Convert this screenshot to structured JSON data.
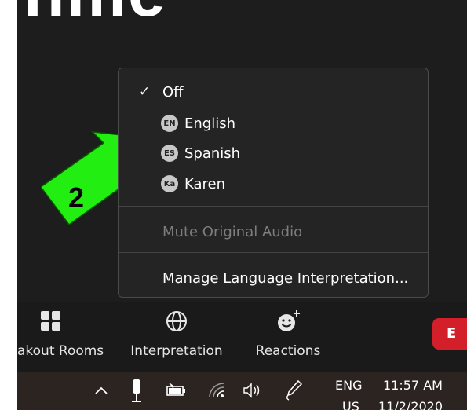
{
  "background": {
    "text": "hme"
  },
  "annotation": {
    "number": "2",
    "arrow_color": "#22ee11"
  },
  "interpretation_menu": {
    "items": [
      {
        "label": "Off",
        "checked": true,
        "badge": ""
      },
      {
        "label": "English",
        "checked": false,
        "badge": "EN"
      },
      {
        "label": "Spanish",
        "checked": false,
        "badge": "ES"
      },
      {
        "label": "Karen",
        "checked": false,
        "badge": "Ka"
      }
    ],
    "mute_original_audio": "Mute Original Audio",
    "manage": "Manage Language Interpretation..."
  },
  "toolbar": {
    "breakout_rooms": "akout Rooms",
    "interpretation": "Interpretation",
    "reactions": "Reactions",
    "end": "E"
  },
  "taskbar": {
    "icons": [
      "chevron-up-icon",
      "microphone-icon",
      "battery-icon",
      "wifi-icon",
      "speaker-icon",
      "pen-icon"
    ],
    "language_top": "ENG",
    "language_bottom": "US",
    "time": "11:57 AM",
    "date": "11/2/2020"
  },
  "colors": {
    "end_button": "#d21f2a",
    "menu_bg": "#242424",
    "arrow": "#22ee11"
  }
}
